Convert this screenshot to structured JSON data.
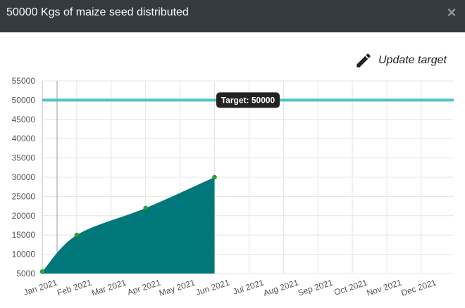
{
  "modal": {
    "title": "50000 Kgs of maize seed distributed",
    "close_symbol": "×",
    "update_label": "Update target",
    "icons": {
      "close": "close-icon",
      "update": "pencil-icon"
    }
  },
  "colors": {
    "header_bg": "#343a40",
    "area_fill": "#00787a",
    "point": "#22aa22",
    "target_line": "#4ec4c6",
    "tooltip_bg": "#222222"
  },
  "chart_data": {
    "type": "area",
    "x": [
      "Jan 2021",
      "Feb 2021",
      "Mar 2021",
      "Apr 2021",
      "May 2021",
      "Jun 2021",
      "Jul 2021",
      "Aug 2021",
      "Sep 2021",
      "Oct 2021",
      "Nov 2021",
      "Dec 2021"
    ],
    "series": [
      {
        "values": [
          5500,
          15000,
          null,
          22000,
          null,
          30000
        ]
      }
    ],
    "ylim": [
      5000,
      55000
    ],
    "yticks": [
      5000,
      10000,
      15000,
      20000,
      25000,
      30000,
      35000,
      40000,
      45000,
      50000,
      55000
    ],
    "target": {
      "value": 50000,
      "label": "Target: 50000"
    },
    "grid": true
  }
}
